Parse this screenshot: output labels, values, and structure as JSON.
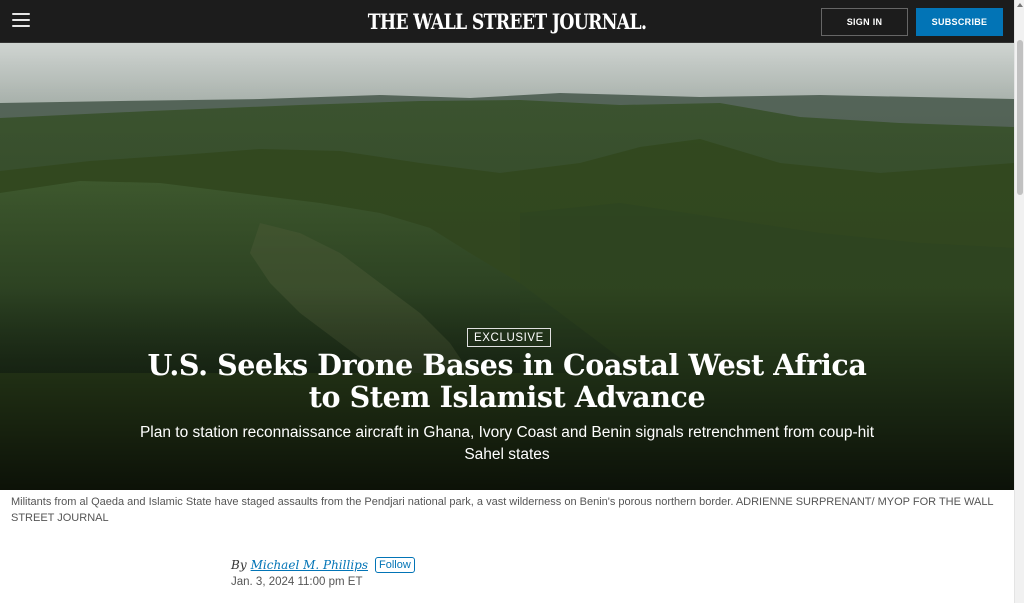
{
  "header": {
    "masthead": "THE WALL STREET JOURNAL.",
    "sign_in_label": "SIGN IN",
    "subscribe_label": "SUBSCRIBE",
    "colors": {
      "bar": "#1c1c1c",
      "subscribe": "#0274b6"
    }
  },
  "hero": {
    "badge": "EXCLUSIVE",
    "headline_line1": "U.S. Seeks Drone Bases in Coastal West Africa",
    "headline_line2": "to Stem Islamist Advance",
    "dek": "Plan to station reconnaissance aircraft in Ghana, Ivory Coast and Benin signals retrenchment from coup-hit Sahel states"
  },
  "caption": "Militants from al Qaeda and Islamic State have staged assaults from the Pendjari national park, a vast wilderness on Benin's porous northern border. ADRIENNE SURPRENANT/ MYOP FOR THE WALL STREET JOURNAL",
  "byline": {
    "prefix": "By",
    "author": "Michael M. Phillips",
    "follow_label": "Follow",
    "date": "Jan. 3, 2024 11:00 pm ET"
  },
  "icons": {
    "menu": "hamburger-menu-icon",
    "scroll_up": "scroll-up-arrow-icon"
  }
}
